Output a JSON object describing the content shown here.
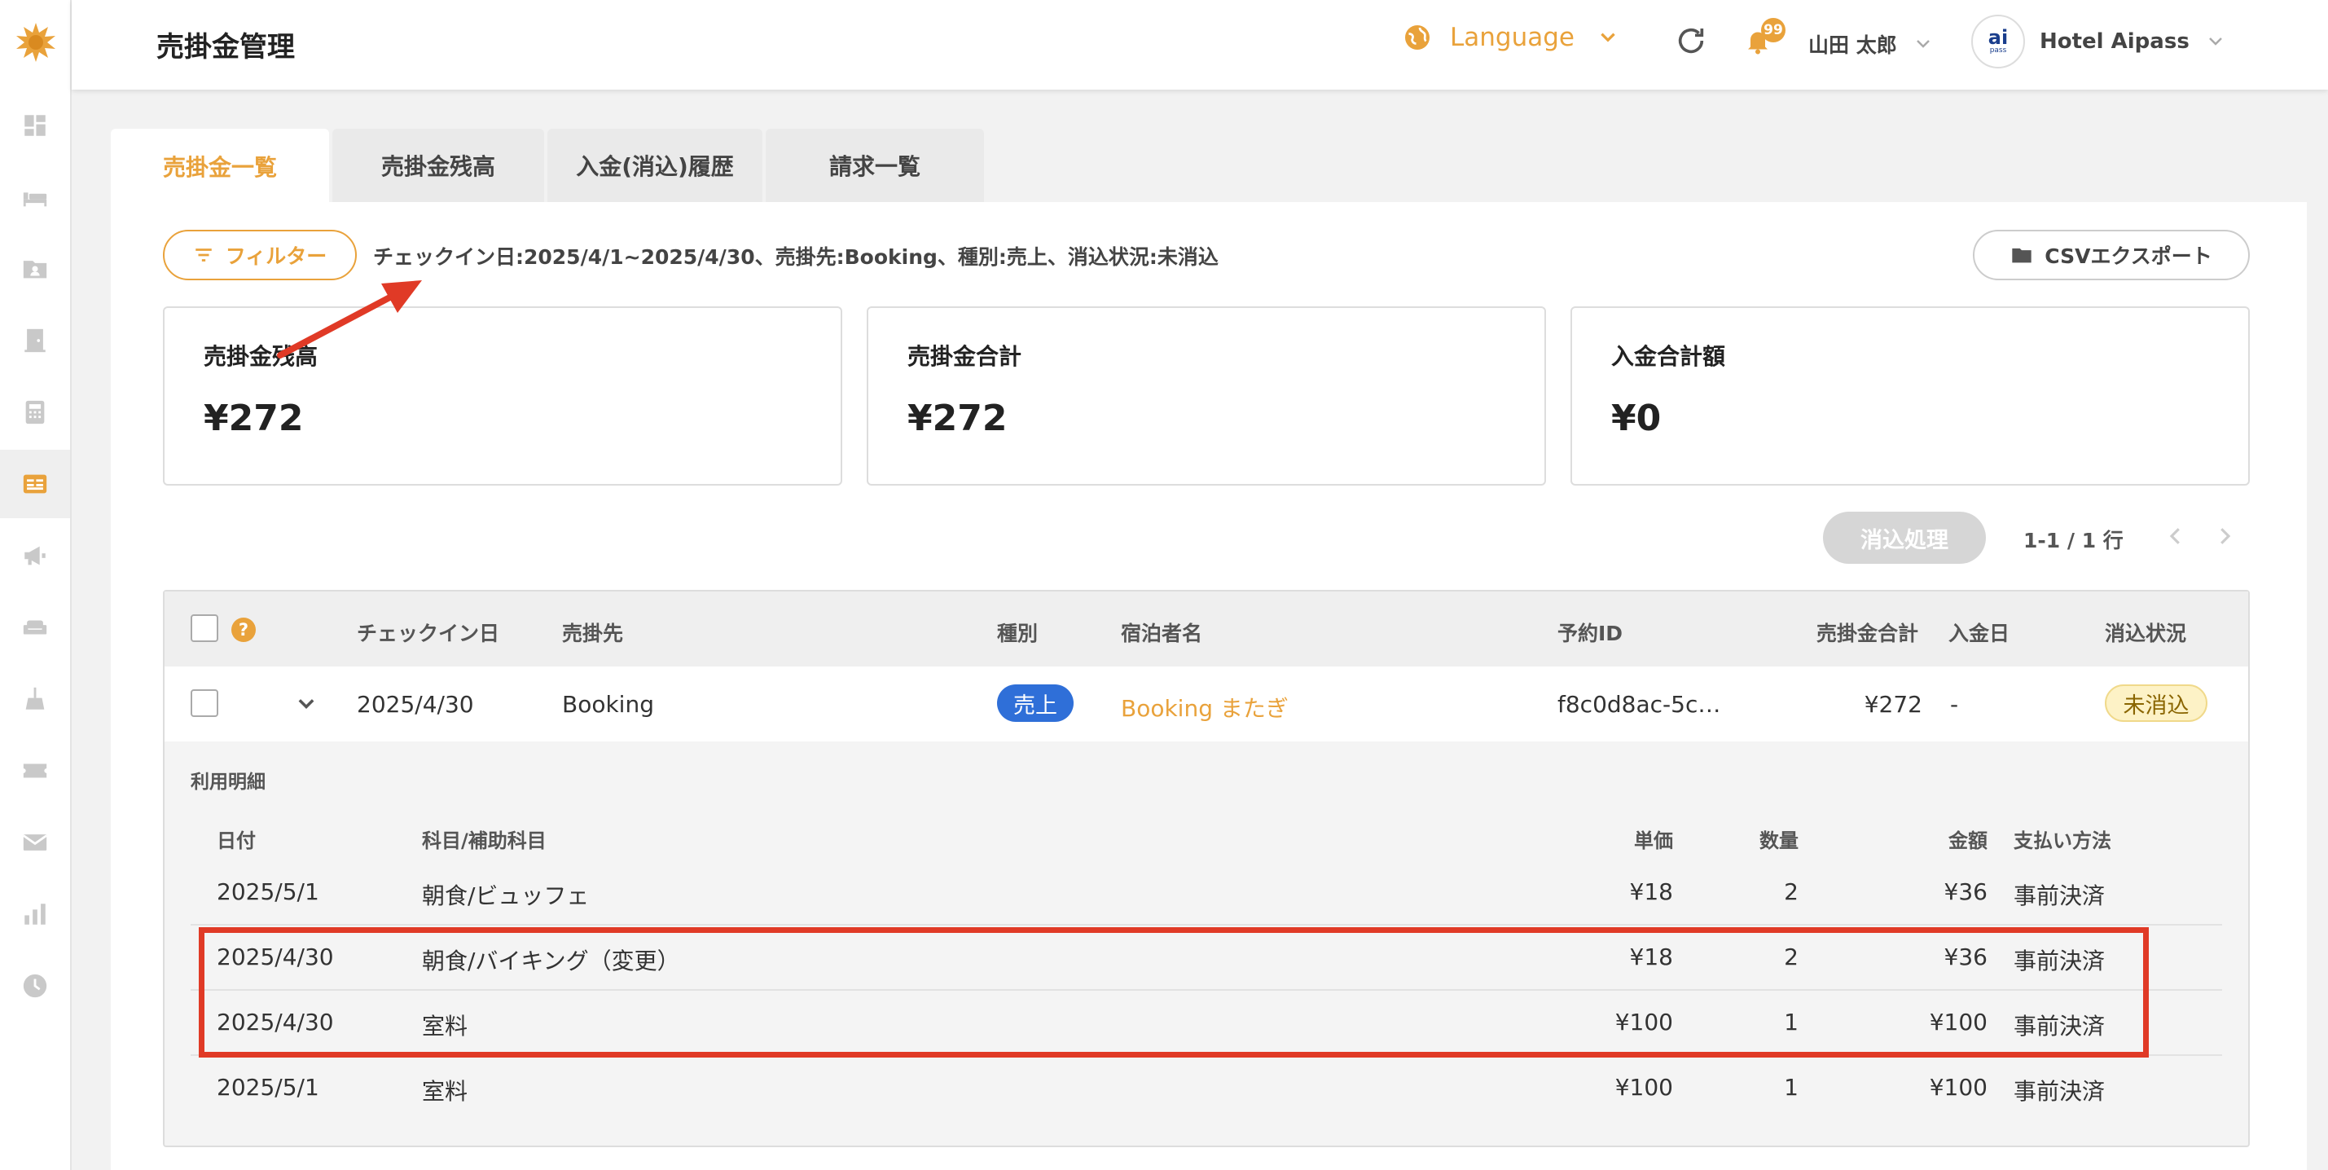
{
  "app": {
    "page_title": "売掛金管理",
    "language_label": "Language",
    "notification_count": "99",
    "user_name": "山田 太郎",
    "avatar_text": "ai",
    "avatar_subtext": "pass",
    "hotel_name": "Hotel Aipass"
  },
  "sidebar": {
    "items": [
      {
        "icon": "dashboard-icon"
      },
      {
        "icon": "bed-icon"
      },
      {
        "icon": "folder-user-icon"
      },
      {
        "icon": "door-icon"
      },
      {
        "icon": "calculator-icon"
      },
      {
        "icon": "receivable-icon",
        "active": true
      },
      {
        "icon": "megaphone-icon"
      },
      {
        "icon": "sofa-icon"
      },
      {
        "icon": "cleaning-icon"
      },
      {
        "icon": "ticket-icon"
      },
      {
        "icon": "mail-icon"
      },
      {
        "icon": "bar-chart-icon"
      },
      {
        "icon": "clock-icon"
      }
    ]
  },
  "tabs": [
    {
      "label": "売掛金一覧",
      "active": true
    },
    {
      "label": "売掛金残高"
    },
    {
      "label": "入金(消込)履歴"
    },
    {
      "label": "請求一覧"
    }
  ],
  "toolbar": {
    "filter_label": "フィルター",
    "filter_summary": "チェックイン日:2025/4/1~2025/4/30、売掛先:Booking、種別:売上、消込状況:未消込",
    "csv_label": "CSVエクスポート"
  },
  "summary_cards": [
    {
      "label": "売掛金残高",
      "value": "¥272"
    },
    {
      "label": "売掛金合計",
      "value": "¥272"
    },
    {
      "label": "入金合計額",
      "value": "¥0"
    }
  ],
  "actions": {
    "settle_label": "消込処理",
    "pager_text": "1-1 / 1 行"
  },
  "table": {
    "help_mark": "?",
    "headers": {
      "checkin": "チェックイン日",
      "customer": "売掛先",
      "type": "種別",
      "guest": "宿泊者名",
      "reservation_id": "予約ID",
      "total": "売掛金合計",
      "payment_date": "入金日",
      "status": "消込状況"
    },
    "rows": [
      {
        "checkin": "2025/4/30",
        "customer": "Booking",
        "type": "売上",
        "guest": "Booking またぎ",
        "reservation_id": "f8c0d8ac-5c…",
        "total": "¥272",
        "payment_date": "-",
        "status": "未消込"
      }
    ]
  },
  "details": {
    "title": "利用明細",
    "headers": {
      "date": "日付",
      "item": "科目/補助科目",
      "unit_price": "単価",
      "quantity": "数量",
      "amount": "金額",
      "method": "支払い方法"
    },
    "rows": [
      {
        "date": "2025/5/1",
        "item": "朝食/ビュッフェ",
        "unit_price": "¥18",
        "quantity": "2",
        "amount": "¥36",
        "method": "事前決済"
      },
      {
        "date": "2025/4/30",
        "item": "朝食/バイキング（変更）",
        "unit_price": "¥18",
        "quantity": "2",
        "amount": "¥36",
        "method": "事前決済"
      },
      {
        "date": "2025/4/30",
        "item": "室料",
        "unit_price": "¥100",
        "quantity": "1",
        "amount": "¥100",
        "method": "事前決済"
      },
      {
        "date": "2025/5/1",
        "item": "室料",
        "unit_price": "¥100",
        "quantity": "1",
        "amount": "¥100",
        "method": "事前決済"
      }
    ]
  },
  "colors": {
    "accent": "#e9a23b",
    "sales_pill": "#2f6fd8",
    "status_pill": "#fdf2c6",
    "annotation_red": "#e03a26"
  }
}
